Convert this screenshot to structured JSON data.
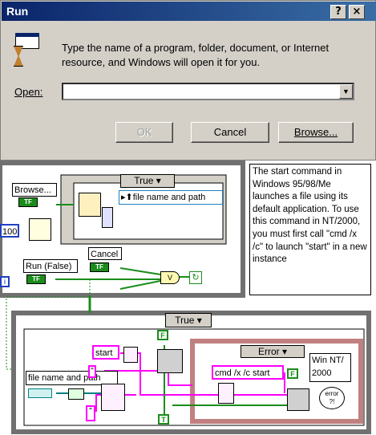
{
  "dialog": {
    "title": "Run",
    "help_btn": "?",
    "close_btn": "×",
    "description": "Type the name of a program, folder, document, or Internet resource, and Windows will open it for you.",
    "open_label": "Open:",
    "open_value": "",
    "ok": "OK",
    "cancel": "Cancel",
    "browse": "Browse..."
  },
  "diagram": {
    "case1_selector": "True",
    "browse_label": "Browse...",
    "fp_label": "file name and path",
    "wait_value": "100",
    "run_label": "Run (False)",
    "cancel_label": "Cancel",
    "note": "The start command in Windows 95/98/Me launches a file using its default application. To use this command in NT/2000, you must first call \"cmd /x /c\" to launch \"start\" in a new instance",
    "case2_selector": "True",
    "start_const": "start",
    "fp_label2": "file name and path",
    "error_selector": "Error",
    "cmd_const": "cmd /x /c start",
    "winnt_label": "Win NT/\n2000",
    "error_icon_text": "error\n?!",
    "tf_const": "TF",
    "f_const": "F",
    "t_const": "T",
    "i_label": "i",
    "quote1": "\"",
    "quote2": "\""
  },
  "colors": {
    "titlebar": "#0a246a",
    "bool_wire": "#1b8c1b",
    "string_wire": "#ff00ff",
    "error_frame": "#c08080"
  }
}
